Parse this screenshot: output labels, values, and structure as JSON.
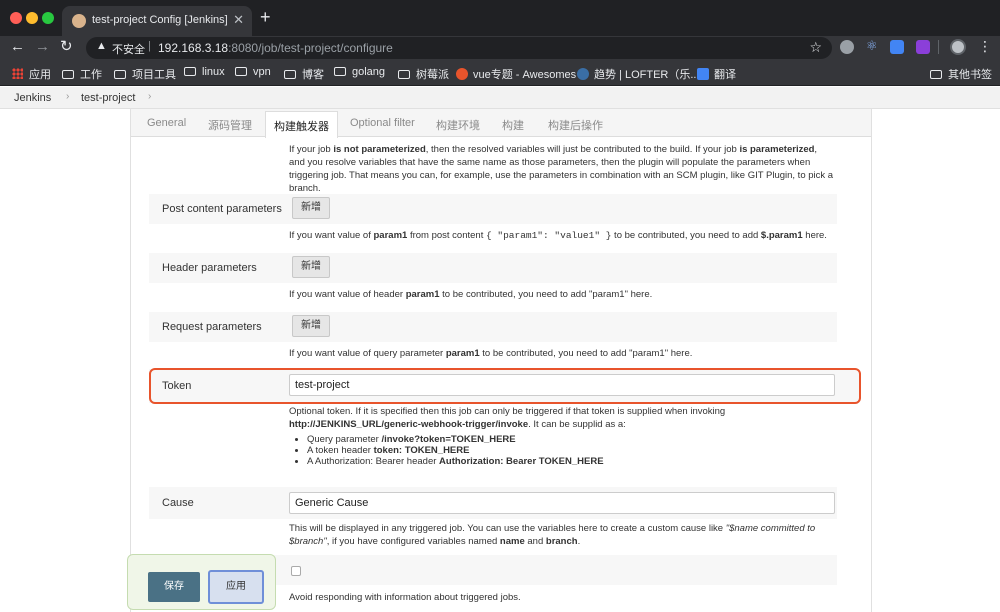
{
  "browser": {
    "tab_title": "test-project Config [Jenkins]",
    "tab_close": "✕",
    "new_tab": "+",
    "insecure_label": "不安全",
    "url_host": "192.168.3.18",
    "url_path": ":8080/job/test-project/configure",
    "bookmarks": [
      {
        "label": "应用",
        "icon": "apps-icon"
      },
      {
        "label": "工作",
        "icon": "folder-icon"
      },
      {
        "label": "项目工具",
        "icon": "folder-icon"
      },
      {
        "label": "linux",
        "icon": "folder-icon"
      },
      {
        "label": "vpn",
        "icon": "folder-icon"
      },
      {
        "label": "博客",
        "icon": "folder-icon"
      },
      {
        "label": "golang",
        "icon": "folder-icon"
      },
      {
        "label": "树莓派",
        "icon": "folder-icon"
      },
      {
        "label": "vue专题 - Awesomes",
        "icon": "site-icon"
      },
      {
        "label": "趋势 | LOFTER（乐...",
        "icon": "site-icon"
      },
      {
        "label": "翻译",
        "icon": "translate-icon"
      },
      {
        "label": "其他书签",
        "icon": "folder-icon"
      }
    ]
  },
  "breadcrumb": {
    "items": [
      "Jenkins",
      "test-project"
    ],
    "separator": "›"
  },
  "config": {
    "tabs": [
      {
        "label": "General",
        "active": false
      },
      {
        "label": "源码管理",
        "active": false
      },
      {
        "label": "构建触发器",
        "active": true
      },
      {
        "label": "Optional filter",
        "active": false
      },
      {
        "label": "构建环境",
        "active": false
      },
      {
        "label": "构建",
        "active": false
      },
      {
        "label": "构建后操作",
        "active": false
      }
    ],
    "intro_desc": {
      "p1": "If your job ",
      "b1": "is not parameterized",
      "p2": ", then the resolved variables will just be contributed to the build. If your job ",
      "b2": "is parameterized",
      "p3": ", and you resolve variables that have the same name as those parameters, then the plugin will populate the parameters when triggering job. That means you can, for example, use the parameters in combination with an SCM plugin, like GIT Plugin, to pick a branch."
    },
    "post_content": {
      "label": "Post content parameters",
      "add_label": "新增",
      "desc_a": "If you want value of ",
      "desc_b": "param1",
      "desc_c": " from post content ",
      "desc_code": "{ \"param1\": \"value1\" }",
      "desc_d": " to be contributed, you need to add ",
      "desc_e": "$.param1",
      "desc_f": " here."
    },
    "header_params": {
      "label": "Header parameters",
      "add_label": "新增",
      "desc_a": "If you want value of header ",
      "desc_b": "param1",
      "desc_c": " to be contributed, you need to add \"param1\" here."
    },
    "request_params": {
      "label": "Request parameters",
      "add_label": "新增",
      "desc_a": "If you want value of query parameter ",
      "desc_b": "param1",
      "desc_c": " to be contributed, you need to add \"param1\" here."
    },
    "token": {
      "label": "Token",
      "value": "test-project",
      "desc_a": "Optional token. If it is specified then this job can only be triggered if that token is supplied when invoking",
      "desc_b": "http://JENKINS_URL/generic-webhook-trigger/invoke",
      "desc_c": ". It can be supplid as a:",
      "bullets": [
        {
          "a": "Query parameter ",
          "b": "/invoke?token=TOKEN_HERE"
        },
        {
          "a": "A token header ",
          "b": "token: TOKEN_HERE"
        },
        {
          "a": "A Authorization: Bearer header ",
          "b": "Authorization: Bearer TOKEN_HERE"
        }
      ]
    },
    "cause": {
      "label": "Cause",
      "value": "Generic Cause",
      "desc_a": "This will be displayed in any triggered job. You can use the variables here to create a custom cause like ",
      "desc_i": "\"$name committed to $branch\"",
      "desc_b": ", if you have configured variables named ",
      "desc_c": "name",
      "desc_d": " and ",
      "desc_e": "branch",
      "desc_f": "."
    },
    "silent": {
      "desc": "Avoid responding with information about triggered jobs."
    }
  },
  "actions": {
    "save_label": "保存",
    "apply_label": "应用"
  }
}
